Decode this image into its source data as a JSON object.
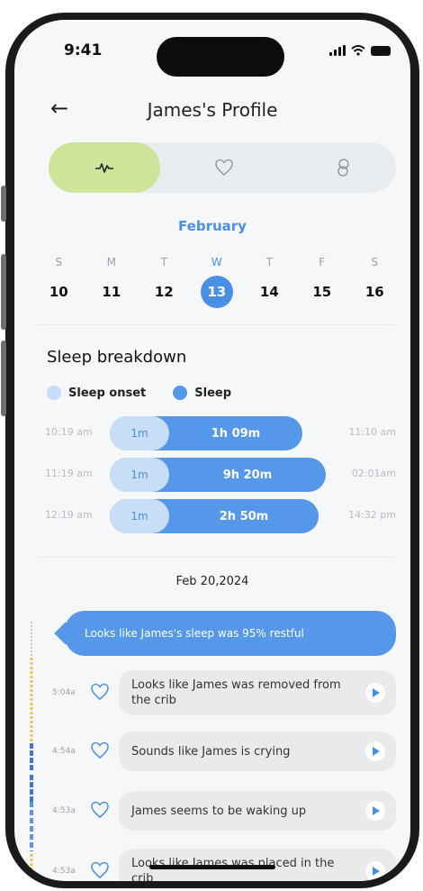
{
  "status": {
    "time": "9:41"
  },
  "header": {
    "title": "James's  Profile"
  },
  "tabs": [
    {
      "icon": "activity-icon",
      "active": true
    },
    {
      "icon": "heart-icon",
      "active": false
    },
    {
      "icon": "linked-rings-icon",
      "active": false
    }
  ],
  "calendar": {
    "month": "February",
    "days": [
      {
        "dow": "S",
        "num": "10"
      },
      {
        "dow": "M",
        "num": "11"
      },
      {
        "dow": "T",
        "num": "12"
      },
      {
        "dow": "W",
        "num": "13"
      },
      {
        "dow": "T",
        "num": "14"
      },
      {
        "dow": "F",
        "num": "15"
      },
      {
        "dow": "S",
        "num": "16"
      }
    ],
    "selected_day": "13"
  },
  "sleep": {
    "title": "Sleep breakdown",
    "legend": {
      "onset": "Sleep onset",
      "sleep": "Sleep"
    },
    "rows": [
      {
        "start": "10:19 am",
        "onset": "1m",
        "duration": "1h 09m",
        "end": "11:10 am"
      },
      {
        "start": "11:19 am",
        "onset": "1m",
        "duration": "9h 20m",
        "end": "02:01am"
      },
      {
        "start": "12:19 am",
        "onset": "1m",
        "duration": "2h 50m",
        "end": "14:32 pm"
      }
    ]
  },
  "feed": {
    "date": "Feb 20,2024",
    "summary": "Looks like James's sleep was 95% restful",
    "items": [
      {
        "time": "5:04a",
        "text": "Looks like James was removed from the crib"
      },
      {
        "time": "4:54a",
        "text": "Sounds like James is crying"
      },
      {
        "time": "4:53a",
        "text": "James seems to be waking up"
      },
      {
        "time": "4:53a",
        "text": "Looks like James was placed in the crib"
      }
    ]
  },
  "colors": {
    "accent": "#4a90e2",
    "tab_active": "#cde49a",
    "onset": "#c8ddf6",
    "sleep": "#5598ea"
  }
}
